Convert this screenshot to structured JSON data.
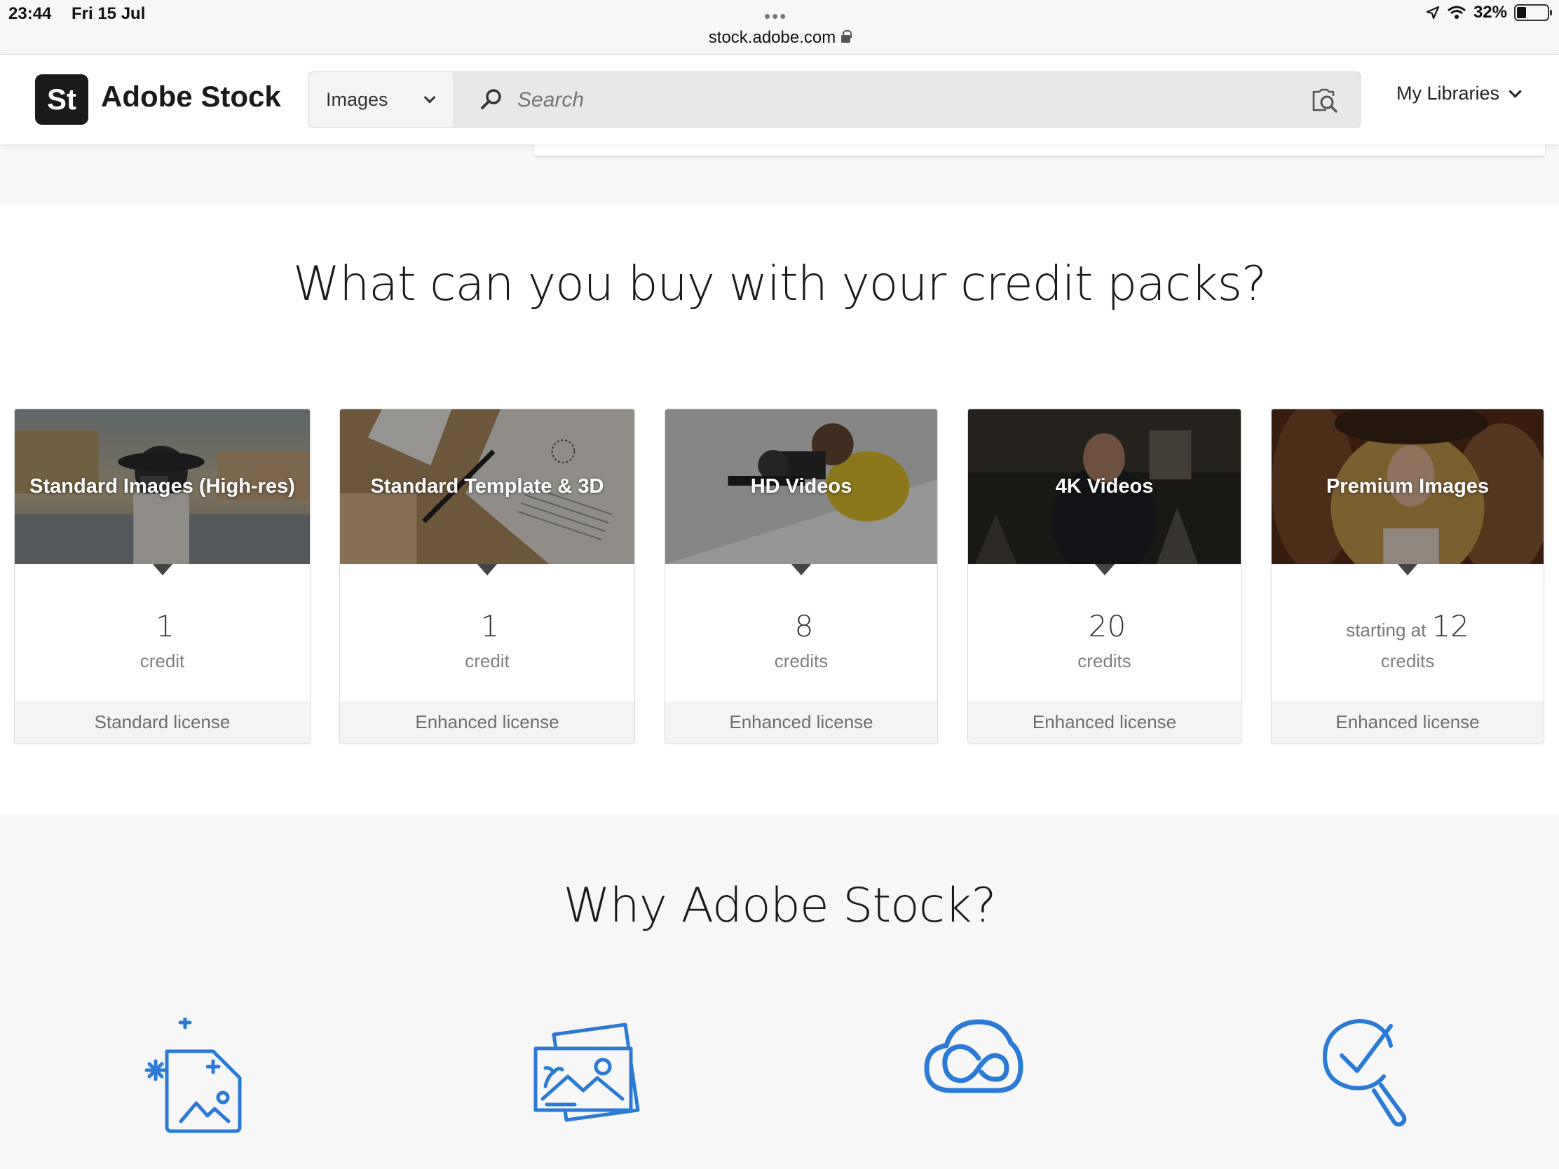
{
  "status_bar": {
    "time": "23:44",
    "date": "Fri 15 Jul",
    "url": "stock.adobe.com",
    "battery": "32%",
    "battery_level": 0.32
  },
  "header": {
    "logo_text": "St",
    "brand": "Adobe Stock",
    "asset_type": "Images",
    "search_placeholder": "Search",
    "libraries_label": "My Libraries"
  },
  "credits_section": {
    "title": "What can you buy with your credit packs?",
    "cards": [
      {
        "title": "Standard Images (High-res)",
        "prefix": "",
        "amount": "1",
        "unit": "credit",
        "license": "Standard license"
      },
      {
        "title": "Standard Template & 3D",
        "prefix": "",
        "amount": "1",
        "unit": "credit",
        "license": "Enhanced license"
      },
      {
        "title": "HD Videos",
        "prefix": "",
        "amount": "8",
        "unit": "credits",
        "license": "Enhanced license"
      },
      {
        "title": "4K Videos",
        "prefix": "",
        "amount": "20",
        "unit": "credits",
        "license": "Enhanced license"
      },
      {
        "title": "Premium Images",
        "prefix": "starting at",
        "amount": "12",
        "unit": "credits",
        "license": "Enhanced license"
      }
    ]
  },
  "why_section": {
    "title": "Why Adobe Stock?",
    "icons": [
      "sparkle-file-image-icon",
      "photo-stack-icon",
      "creative-cloud-icon",
      "search-check-icon"
    ]
  },
  "colors": {
    "accent_blue": "#2a7ad6",
    "dark": "#1a1a1a"
  }
}
